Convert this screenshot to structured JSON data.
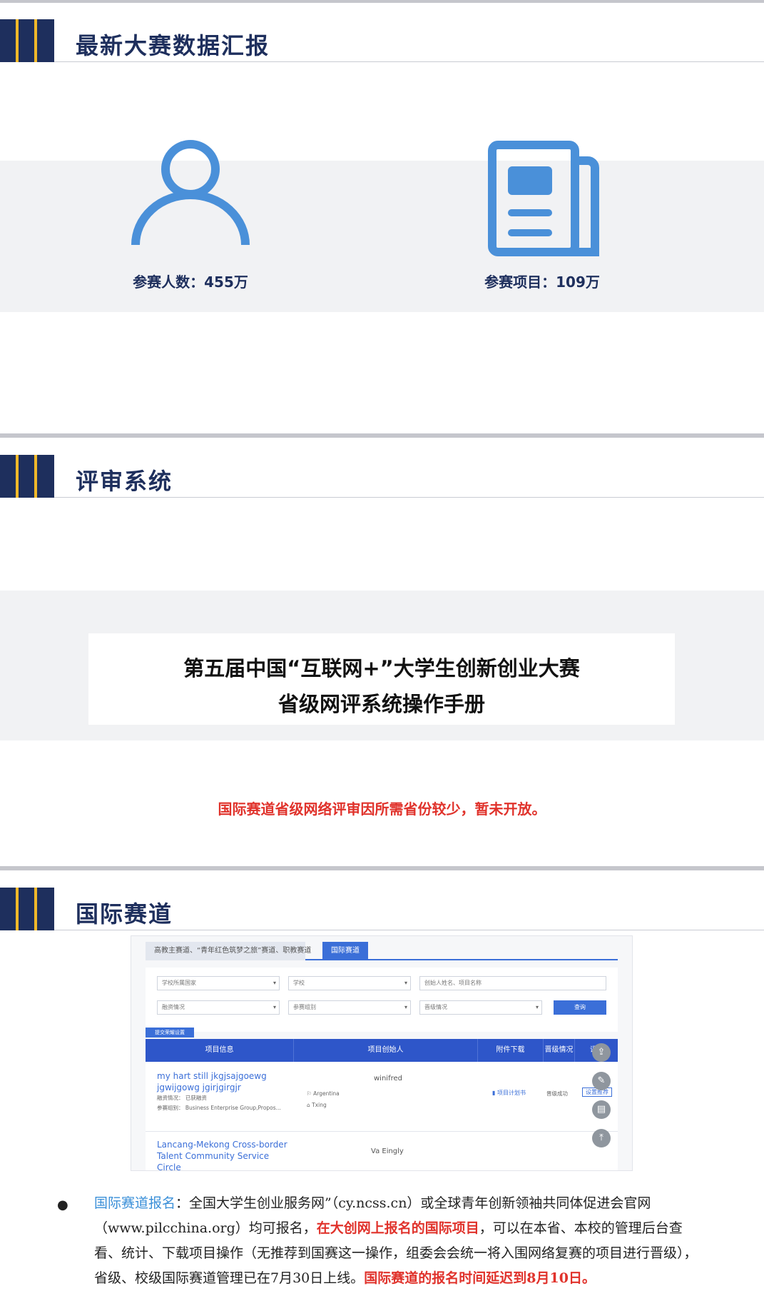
{
  "section1": {
    "title": "最新大赛数据汇报",
    "stats": [
      {
        "icon": "person-icon",
        "label": "参赛人数：455万"
      },
      {
        "icon": "document-icon",
        "label": "参赛项目：109万"
      }
    ]
  },
  "section2": {
    "title": "评审系统",
    "manual_line1": "第五届中国“互联网+”大学生创新创业大赛",
    "manual_line2": "省级网评系统操作手册",
    "notice": "国际赛道省级网络评审因所需省份较少，暂未开放。"
  },
  "section3": {
    "title": "国际赛道",
    "screenshot": {
      "tab1": "高教主赛道、“青年红色筑梦之旅”赛道、职教赛道",
      "tab2": "国际赛道",
      "filter_school_country": "学校所属国家",
      "filter_school": "学校",
      "filter_search_placeholder": "创始人姓名、项目名称",
      "filter_funding": "融资情况",
      "filter_group": "参赛组别",
      "filter_promotion": "晋级情况",
      "query_button": "查询",
      "settings_button": "提交荣耀设置",
      "columns": [
        "项目信息",
        "项目创始人",
        "附件下载",
        "晋级情况",
        "评审"
      ],
      "rows": [
        {
          "title_line1": "my hart still jkgjsajgoewg",
          "title_line2": "jgwijgowg jgirjgirgjr",
          "funding": "融资情况：  已获融资",
          "group": "参赛组别：  Business Enterprise Group,Propos...",
          "founder": "winifred",
          "country": "Argentina",
          "school": "Txing",
          "attachment": "项目计划书",
          "status": "晋级成功",
          "action": "设置推荐"
        },
        {
          "title_line1": "Lancang-Mekong Cross-border",
          "title_line2": "Talent Community Service",
          "title_line3": "Circle",
          "founder": "Va Eingly"
        }
      ],
      "float_icons": [
        "share-icon",
        "edit-icon",
        "note-icon",
        "to-top-icon"
      ]
    },
    "bullet": {
      "label": "国际赛道报名",
      "colon": "：",
      "text1": "全国大学生创业服务网”（cy.ncss.cn）或全球青年创新领袖共同体促进会官网（www.pilcchina.org）均可报名，",
      "red1": "在大创网上报名的国际项目",
      "text2": "，可以在本省、本校的管理后台查看、统计、下载项目操作（无推荐到国赛这一操作，组委会会统一将入围网络复赛的项目进行晋级），省级、校级国际赛道管理已在7月30日上线。",
      "red2": "国际赛道的报名时间延迟到8月10日。"
    }
  },
  "colors": {
    "navy": "#1e2f5d",
    "gold": "#f0b92a",
    "icon_blue": "#4a90d9",
    "red": "#e0322b",
    "label_blue": "#3a8fd8"
  }
}
